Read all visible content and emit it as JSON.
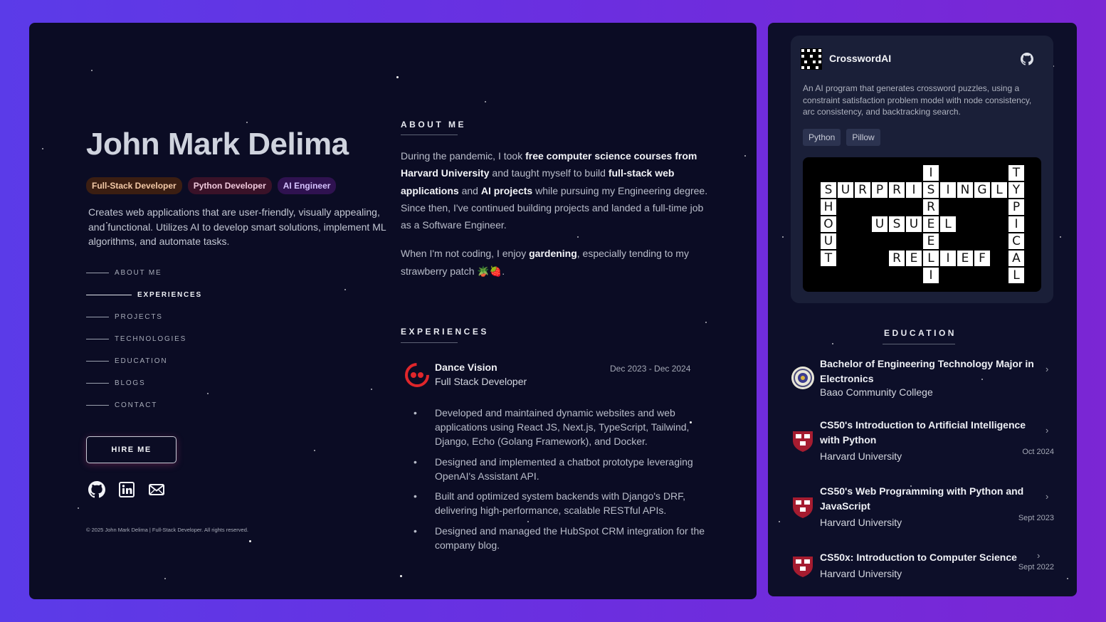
{
  "profile": {
    "name": "John Mark Delima",
    "badges": [
      "Full-Stack Developer",
      "Python Developer",
      "AI Engineer"
    ],
    "intro": "Creates web applications that are user-friendly, visually appealing, and functional. Utilizes AI to develop smart solutions, implement ML algorithms, and automate tasks.",
    "hire_label": "HIRE ME",
    "footer": "© 2025 John Mark Delima | Full-Stack Developer. All rights reserved.",
    "socials": [
      "github-icon",
      "linkedin-icon",
      "mail-icon"
    ]
  },
  "nav": {
    "items": [
      "ABOUT ME",
      "EXPERIENCES",
      "PROJECTS",
      "TECHNOLOGIES",
      "EDUCATION",
      "BLOGS",
      "CONTACT"
    ],
    "active": "EXPERIENCES"
  },
  "about": {
    "title": "ABOUT ME",
    "p1": [
      {
        "t": "During the pandemic, I took ",
        "b": false
      },
      {
        "t": "free computer science courses from Harvard University",
        "b": true
      },
      {
        "t": " and taught myself to build ",
        "b": false
      },
      {
        "t": "full-stack web applications",
        "b": true
      },
      {
        "t": " and ",
        "b": false
      },
      {
        "t": "AI projects",
        "b": true
      },
      {
        "t": " while pursuing my Engineering degree. Since then, I've continued building projects and landed a full-time job as a Software Engineer.",
        "b": false
      }
    ],
    "p2": [
      {
        "t": "When I'm not coding, I enjoy ",
        "b": false
      },
      {
        "t": "gardening",
        "b": true
      },
      {
        "t": ", especially tending to my strawberry patch 🪴🍓.",
        "b": false
      }
    ]
  },
  "experiences": {
    "title": "EXPERIENCES",
    "items": [
      {
        "company": "Dance Vision",
        "role": "Full Stack Developer",
        "date": "Dec 2023 - Dec 2024",
        "bullets": [
          "Developed and maintained dynamic websites and web applications using React JS, Next.js, TypeScript, Tailwind, Django, Echo (Golang Framework), and Docker.",
          "Designed and implemented a chatbot prototype leveraging OpenAI's Assistant API.",
          "Built and optimized system backends with Django's DRF, delivering high-performance, scalable RESTful APIs.",
          "Designed and managed the HubSpot CRM integration for the company blog."
        ]
      }
    ]
  },
  "project": {
    "title": "CrosswordAI",
    "description": "An AI program that generates crossword puzzles, using a constraint satisfaction problem model with node consistency, arc consistency, and backtracking search.",
    "tags": [
      "Python",
      "Pillow"
    ],
    "crossword_words": [
      {
        "word": "SURPRISINGLY",
        "row": 1,
        "col": 0,
        "dir": "across"
      },
      {
        "word": "USUAL",
        "row": 3,
        "col": 3,
        "dir": "across"
      },
      {
        "word": "RELIEF",
        "row": 5,
        "col": 4,
        "dir": "across"
      },
      {
        "word": "SHOUT",
        "row": 1,
        "col": 0,
        "dir": "down"
      },
      {
        "word": "ISREELI",
        "row": 0,
        "col": 6,
        "dir": "down"
      },
      {
        "word": "TYPICAL",
        "row": 0,
        "col": 11,
        "dir": "down"
      }
    ]
  },
  "education": {
    "title": "EDUCATION",
    "items": [
      {
        "name": "Bachelor of Engineering Technology Major in Electronics",
        "school": "Baao Community College",
        "date": "",
        "logo": "college-seal-icon"
      },
      {
        "name": "CS50's Introduction to Artificial Intelligence with Python",
        "school": "Harvard University",
        "date": "Oct 2024",
        "logo": "harvard-shield-icon"
      },
      {
        "name": "CS50's Web Programming with Python and JavaScript",
        "school": "Harvard University",
        "date": "Sept 2023",
        "logo": "harvard-shield-icon"
      },
      {
        "name": "CS50x: Introduction to Computer Science",
        "school": "Harvard University",
        "date": "Sept 2022",
        "logo": "harvard-shield-icon"
      }
    ]
  },
  "colors": {
    "background_gradient": [
      "#5b3be8",
      "#7b26d4"
    ],
    "card": "#0b0c24",
    "project_card": "#1a1f38"
  }
}
